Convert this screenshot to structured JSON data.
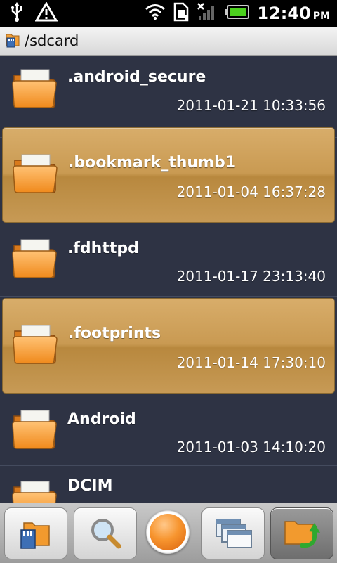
{
  "status_bar": {
    "time": "12:40",
    "ampm": "PM",
    "icons": [
      "usb-icon",
      "warning-icon",
      "wifi-icon",
      "sim-icon",
      "signal-icon",
      "battery-icon"
    ]
  },
  "path_bar": {
    "path": "/sdcard",
    "icon": "sdcard-folder-icon"
  },
  "files": [
    {
      "name": ".android_secure",
      "date": "2011-01-21 10:33:56",
      "selected": false
    },
    {
      "name": ".bookmark_thumb1",
      "date": "2011-01-04 16:37:28",
      "selected": true
    },
    {
      "name": ".fdhttpd",
      "date": "2011-01-17 23:13:40",
      "selected": false
    },
    {
      "name": ".footprints",
      "date": "2011-01-14 17:30:10",
      "selected": true
    },
    {
      "name": "Android",
      "date": "2011-01-03 14:10:20",
      "selected": false
    },
    {
      "name": "DCIM",
      "date": "",
      "selected": false
    }
  ],
  "toolbar": {
    "buttons": [
      "sdcard-button",
      "search-button",
      "home-orb-button",
      "windows-button",
      "refresh-folder-button"
    ],
    "active": "refresh-folder-button"
  },
  "colors": {
    "background": "#2e3344",
    "selection": "#c99a52",
    "folder": "#f29a2e"
  }
}
